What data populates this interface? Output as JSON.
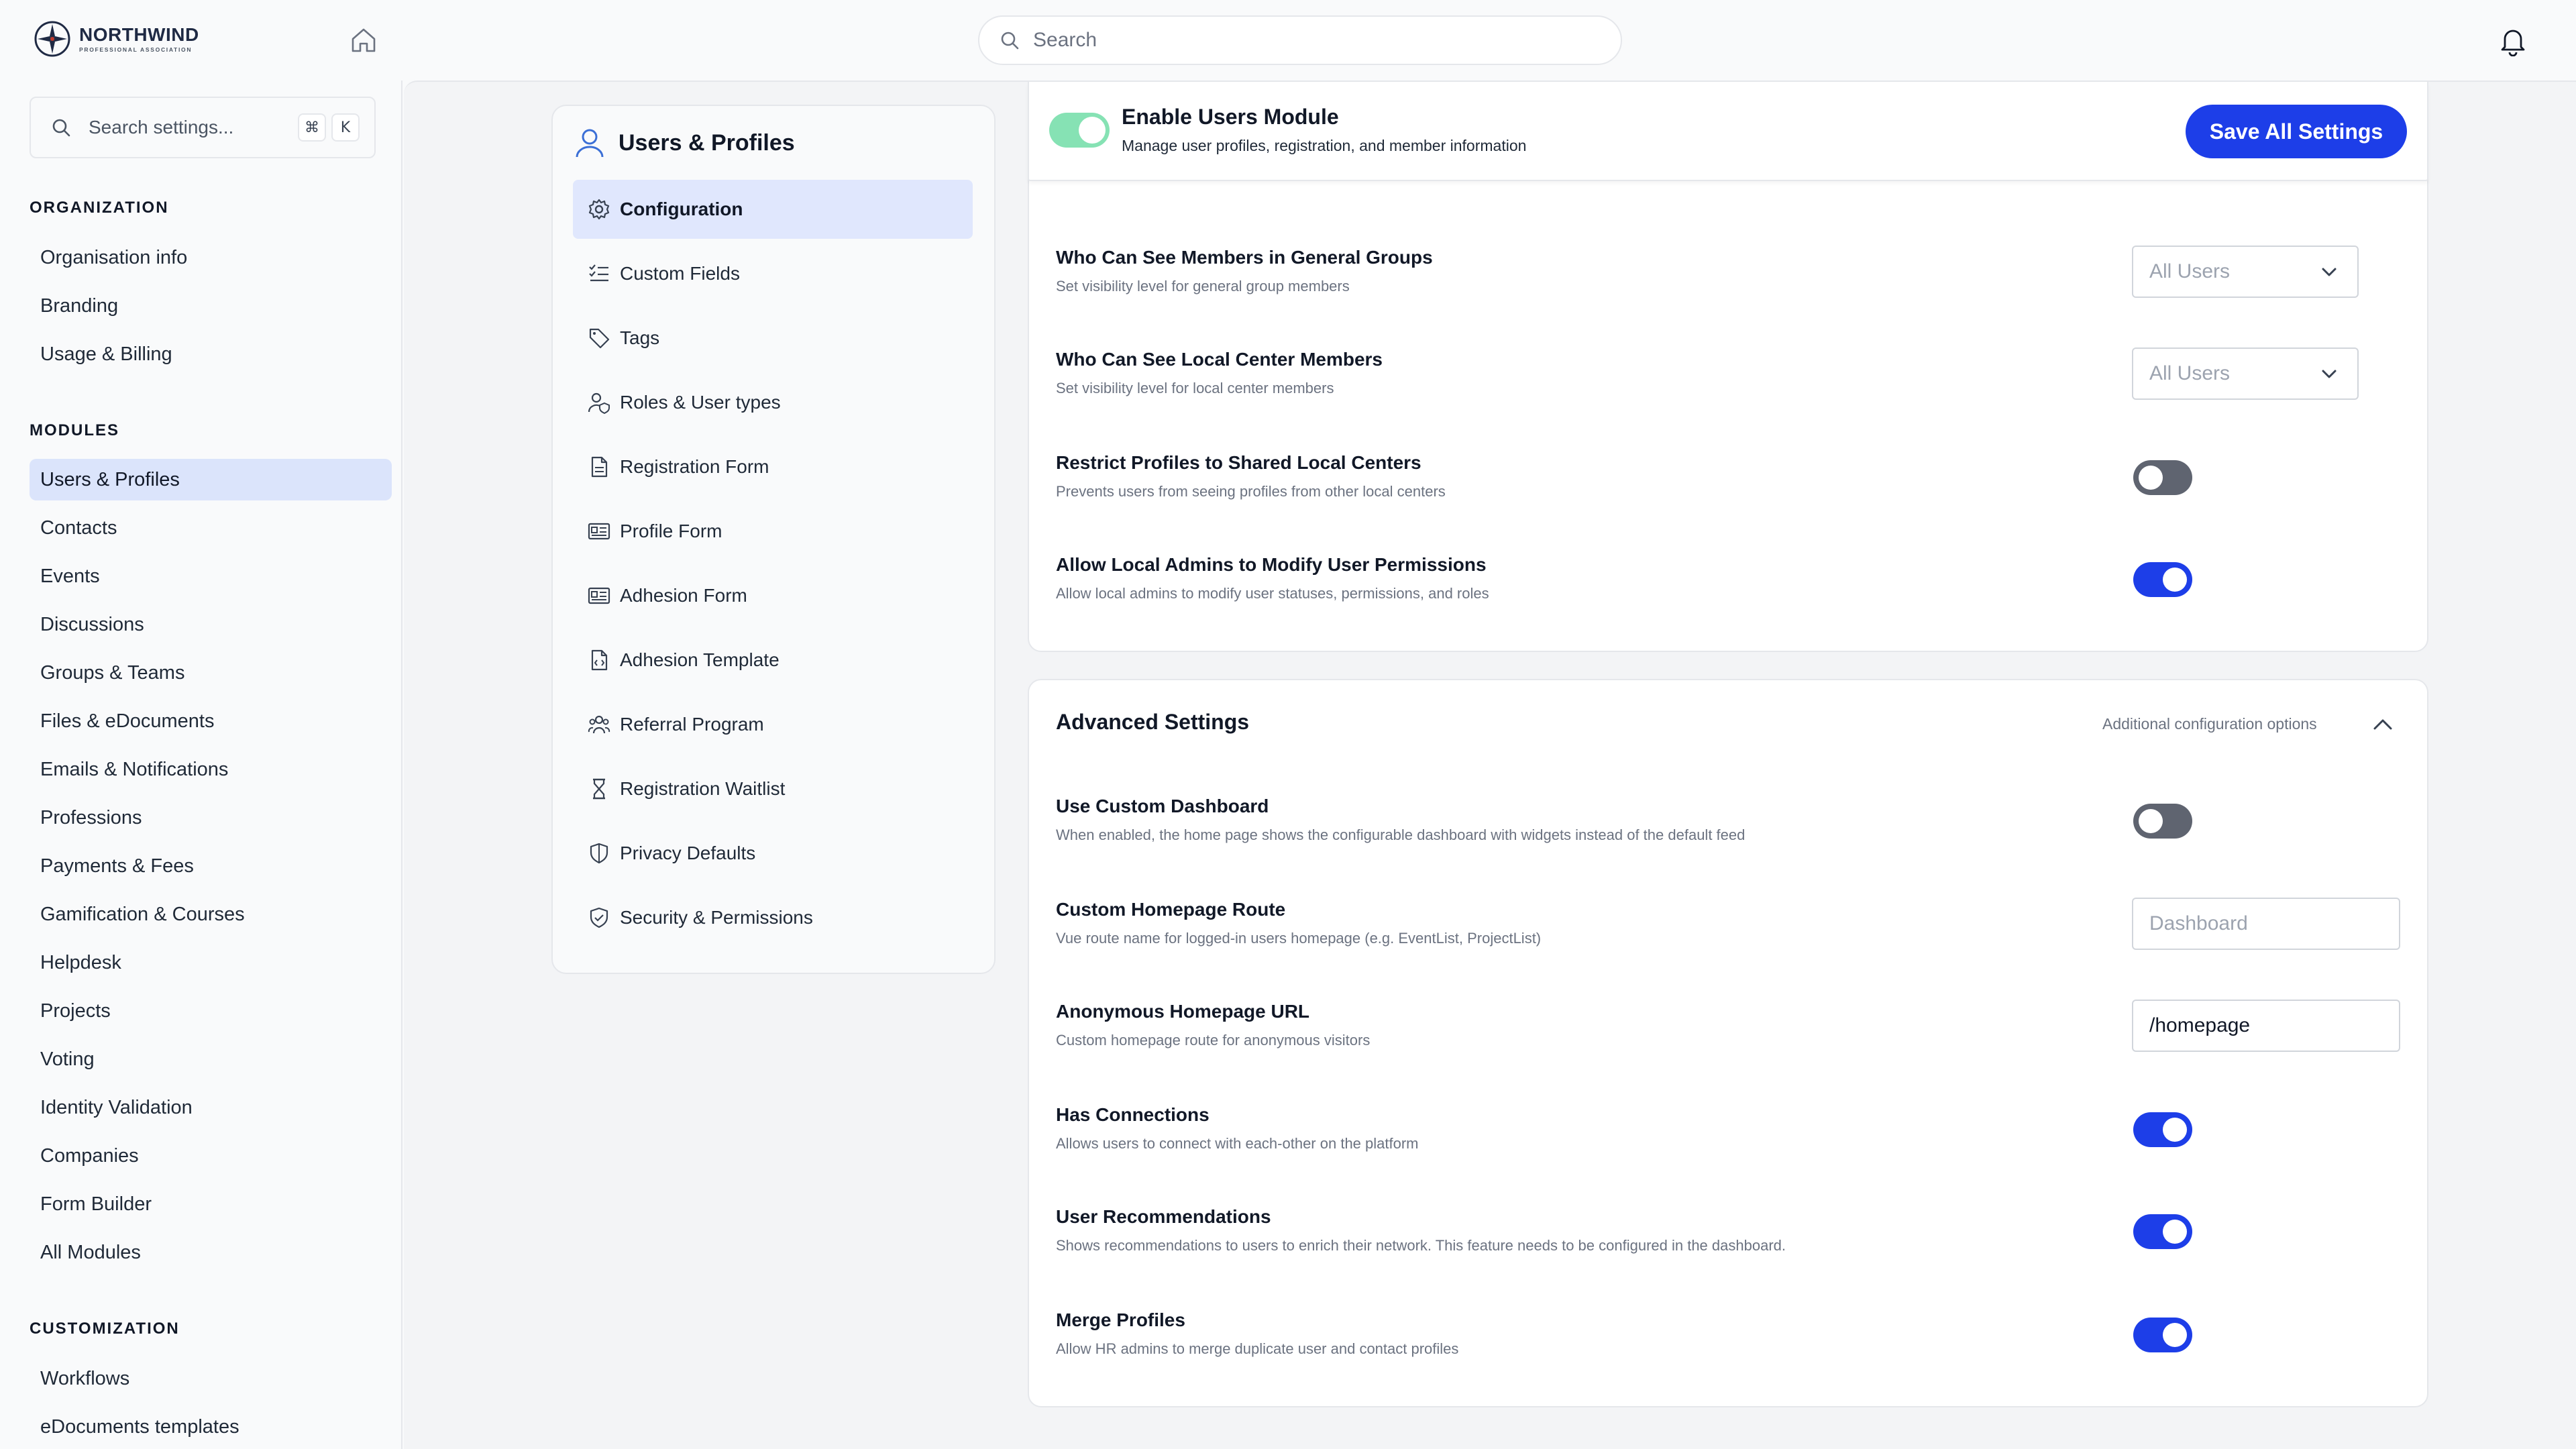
{
  "brand": {
    "name": "NORTHWIND",
    "subtitle": "PROFESSIONAL ASSOCIATION"
  },
  "topbar": {
    "search_placeholder": "Search",
    "home_icon": "home-icon",
    "bell_icon": "bell-icon"
  },
  "sidebar": {
    "search_placeholder": "Search settings...",
    "shortcut_keys": [
      "⌘",
      "K"
    ],
    "sections": [
      {
        "title": "ORGANIZATION",
        "items": [
          "Organisation info",
          "Branding",
          "Usage & Billing"
        ]
      },
      {
        "title": "MODULES",
        "items": [
          "Users & Profiles",
          "Contacts",
          "Events",
          "Discussions",
          "Groups & Teams",
          "Files & eDocuments",
          "Emails & Notifications",
          "Professions",
          "Payments & Fees",
          "Gamification & Courses",
          "Helpdesk",
          "Projects",
          "Voting",
          "Identity Validation",
          "Companies",
          "Form Builder",
          "All Modules"
        ]
      },
      {
        "title": "CUSTOMIZATION",
        "items": [
          "Workflows",
          "eDocuments templates"
        ]
      }
    ],
    "active_item": "Users & Profiles"
  },
  "submenu": {
    "title": "Users & Profiles",
    "items": [
      {
        "label": "Configuration",
        "icon": "gear-icon",
        "active": true
      },
      {
        "label": "Custom Fields",
        "icon": "list-check-icon"
      },
      {
        "label": "Tags",
        "icon": "tag-icon"
      },
      {
        "label": "Roles & User types",
        "icon": "user-shield-icon"
      },
      {
        "label": "Registration Form",
        "icon": "document-icon"
      },
      {
        "label": "Profile Form",
        "icon": "id-card-icon"
      },
      {
        "label": "Adhesion Form",
        "icon": "id-card-icon"
      },
      {
        "label": "Adhesion Template",
        "icon": "file-code-icon"
      },
      {
        "label": "Referral Program",
        "icon": "users-group-icon"
      },
      {
        "label": "Registration Waitlist",
        "icon": "hourglass-icon"
      },
      {
        "label": "Privacy Defaults",
        "icon": "shield-icon"
      },
      {
        "label": "Security & Permissions",
        "icon": "shield-check-icon"
      }
    ]
  },
  "module_header": {
    "title": "Enable Users Module",
    "description": "Manage user profiles, registration, and member information",
    "enabled": true,
    "save_label": "Save All Settings"
  },
  "visibility_settings": [
    {
      "title": "Who Can See Members in General Groups",
      "description": "Set visibility level for general group members",
      "control": "select",
      "value": "All Users"
    },
    {
      "title": "Who Can See Local Center Members",
      "description": "Set visibility level for local center members",
      "control": "select",
      "value": "All Users"
    },
    {
      "title": "Restrict Profiles to Shared Local Centers",
      "description": "Prevents users from seeing profiles from other local centers",
      "control": "toggle",
      "value": false
    },
    {
      "title": "Allow Local Admins to Modify User Permissions",
      "description": "Allow local admins to modify user statuses, permissions, and roles",
      "control": "toggle",
      "value": true
    }
  ],
  "advanced": {
    "title": "Advanced Settings",
    "subtitle": "Additional configuration options",
    "settings": [
      {
        "title": "Use Custom Dashboard",
        "description": "When enabled, the home page shows the configurable dashboard with widgets instead of the default feed",
        "control": "toggle",
        "value": false
      },
      {
        "title": "Custom Homepage Route",
        "description": "Vue route name for logged-in users homepage (e.g. EventList, ProjectList)",
        "control": "input",
        "placeholder": "Dashboard",
        "value": ""
      },
      {
        "title": "Anonymous Homepage URL",
        "description": "Custom homepage route for anonymous visitors",
        "control": "input",
        "placeholder": "",
        "value": "/homepage"
      },
      {
        "title": "Has Connections",
        "description": "Allows users to connect with each-other on the platform",
        "control": "toggle",
        "value": true
      },
      {
        "title": "User Recommendations",
        "description": "Shows recommendations to users to enrich their network. This feature needs to be configured in the dashboard.",
        "control": "toggle",
        "value": true
      },
      {
        "title": "Merge Profiles",
        "description": "Allow HR admins to merge duplicate user and contact profiles",
        "control": "toggle",
        "value": true
      }
    ]
  },
  "colors": {
    "accent": "#1d3ee8",
    "toggle_off": "#5f6470",
    "module_toggle": "#86e2b4",
    "active_nav": "#dbe4fb"
  }
}
